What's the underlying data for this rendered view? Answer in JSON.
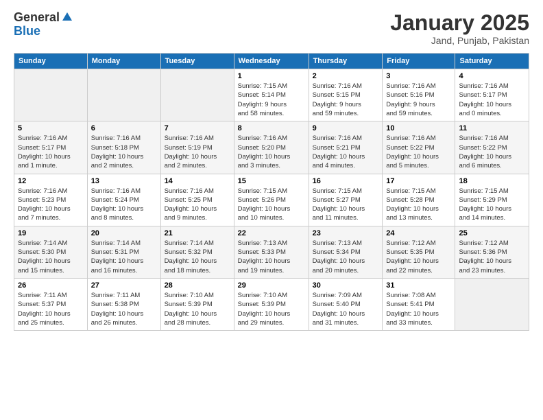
{
  "logo": {
    "general": "General",
    "blue": "Blue"
  },
  "header": {
    "title": "January 2025",
    "subtitle": "Jand, Punjab, Pakistan"
  },
  "days_of_week": [
    "Sunday",
    "Monday",
    "Tuesday",
    "Wednesday",
    "Thursday",
    "Friday",
    "Saturday"
  ],
  "weeks": [
    {
      "days": [
        {
          "number": "",
          "info": ""
        },
        {
          "number": "",
          "info": ""
        },
        {
          "number": "",
          "info": ""
        },
        {
          "number": "1",
          "info": "Sunrise: 7:15 AM\nSunset: 5:14 PM\nDaylight: 9 hours\nand 58 minutes."
        },
        {
          "number": "2",
          "info": "Sunrise: 7:16 AM\nSunset: 5:15 PM\nDaylight: 9 hours\nand 59 minutes."
        },
        {
          "number": "3",
          "info": "Sunrise: 7:16 AM\nSunset: 5:16 PM\nDaylight: 9 hours\nand 59 minutes."
        },
        {
          "number": "4",
          "info": "Sunrise: 7:16 AM\nSunset: 5:17 PM\nDaylight: 10 hours\nand 0 minutes."
        }
      ]
    },
    {
      "days": [
        {
          "number": "5",
          "info": "Sunrise: 7:16 AM\nSunset: 5:17 PM\nDaylight: 10 hours\nand 1 minute."
        },
        {
          "number": "6",
          "info": "Sunrise: 7:16 AM\nSunset: 5:18 PM\nDaylight: 10 hours\nand 2 minutes."
        },
        {
          "number": "7",
          "info": "Sunrise: 7:16 AM\nSunset: 5:19 PM\nDaylight: 10 hours\nand 2 minutes."
        },
        {
          "number": "8",
          "info": "Sunrise: 7:16 AM\nSunset: 5:20 PM\nDaylight: 10 hours\nand 3 minutes."
        },
        {
          "number": "9",
          "info": "Sunrise: 7:16 AM\nSunset: 5:21 PM\nDaylight: 10 hours\nand 4 minutes."
        },
        {
          "number": "10",
          "info": "Sunrise: 7:16 AM\nSunset: 5:22 PM\nDaylight: 10 hours\nand 5 minutes."
        },
        {
          "number": "11",
          "info": "Sunrise: 7:16 AM\nSunset: 5:22 PM\nDaylight: 10 hours\nand 6 minutes."
        }
      ]
    },
    {
      "days": [
        {
          "number": "12",
          "info": "Sunrise: 7:16 AM\nSunset: 5:23 PM\nDaylight: 10 hours\nand 7 minutes."
        },
        {
          "number": "13",
          "info": "Sunrise: 7:16 AM\nSunset: 5:24 PM\nDaylight: 10 hours\nand 8 minutes."
        },
        {
          "number": "14",
          "info": "Sunrise: 7:16 AM\nSunset: 5:25 PM\nDaylight: 10 hours\nand 9 minutes."
        },
        {
          "number": "15",
          "info": "Sunrise: 7:15 AM\nSunset: 5:26 PM\nDaylight: 10 hours\nand 10 minutes."
        },
        {
          "number": "16",
          "info": "Sunrise: 7:15 AM\nSunset: 5:27 PM\nDaylight: 10 hours\nand 11 minutes."
        },
        {
          "number": "17",
          "info": "Sunrise: 7:15 AM\nSunset: 5:28 PM\nDaylight: 10 hours\nand 13 minutes."
        },
        {
          "number": "18",
          "info": "Sunrise: 7:15 AM\nSunset: 5:29 PM\nDaylight: 10 hours\nand 14 minutes."
        }
      ]
    },
    {
      "days": [
        {
          "number": "19",
          "info": "Sunrise: 7:14 AM\nSunset: 5:30 PM\nDaylight: 10 hours\nand 15 minutes."
        },
        {
          "number": "20",
          "info": "Sunrise: 7:14 AM\nSunset: 5:31 PM\nDaylight: 10 hours\nand 16 minutes."
        },
        {
          "number": "21",
          "info": "Sunrise: 7:14 AM\nSunset: 5:32 PM\nDaylight: 10 hours\nand 18 minutes."
        },
        {
          "number": "22",
          "info": "Sunrise: 7:13 AM\nSunset: 5:33 PM\nDaylight: 10 hours\nand 19 minutes."
        },
        {
          "number": "23",
          "info": "Sunrise: 7:13 AM\nSunset: 5:34 PM\nDaylight: 10 hours\nand 20 minutes."
        },
        {
          "number": "24",
          "info": "Sunrise: 7:12 AM\nSunset: 5:35 PM\nDaylight: 10 hours\nand 22 minutes."
        },
        {
          "number": "25",
          "info": "Sunrise: 7:12 AM\nSunset: 5:36 PM\nDaylight: 10 hours\nand 23 minutes."
        }
      ]
    },
    {
      "days": [
        {
          "number": "26",
          "info": "Sunrise: 7:11 AM\nSunset: 5:37 PM\nDaylight: 10 hours\nand 25 minutes."
        },
        {
          "number": "27",
          "info": "Sunrise: 7:11 AM\nSunset: 5:38 PM\nDaylight: 10 hours\nand 26 minutes."
        },
        {
          "number": "28",
          "info": "Sunrise: 7:10 AM\nSunset: 5:39 PM\nDaylight: 10 hours\nand 28 minutes."
        },
        {
          "number": "29",
          "info": "Sunrise: 7:10 AM\nSunset: 5:39 PM\nDaylight: 10 hours\nand 29 minutes."
        },
        {
          "number": "30",
          "info": "Sunrise: 7:09 AM\nSunset: 5:40 PM\nDaylight: 10 hours\nand 31 minutes."
        },
        {
          "number": "31",
          "info": "Sunrise: 7:08 AM\nSunset: 5:41 PM\nDaylight: 10 hours\nand 33 minutes."
        },
        {
          "number": "",
          "info": ""
        }
      ]
    }
  ]
}
